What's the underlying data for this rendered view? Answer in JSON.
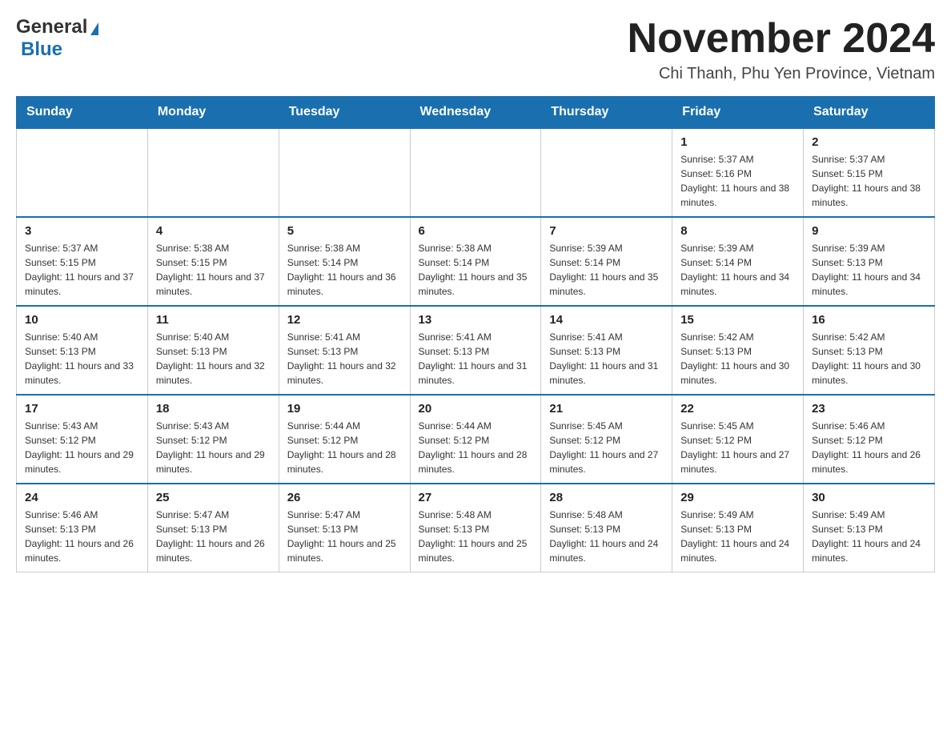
{
  "logo": {
    "general": "General",
    "blue": "Blue"
  },
  "title": "November 2024",
  "location": "Chi Thanh, Phu Yen Province, Vietnam",
  "weekdays": [
    "Sunday",
    "Monday",
    "Tuesday",
    "Wednesday",
    "Thursday",
    "Friday",
    "Saturday"
  ],
  "weeks": [
    [
      {
        "day": "",
        "info": ""
      },
      {
        "day": "",
        "info": ""
      },
      {
        "day": "",
        "info": ""
      },
      {
        "day": "",
        "info": ""
      },
      {
        "day": "",
        "info": ""
      },
      {
        "day": "1",
        "info": "Sunrise: 5:37 AM\nSunset: 5:16 PM\nDaylight: 11 hours and 38 minutes."
      },
      {
        "day": "2",
        "info": "Sunrise: 5:37 AM\nSunset: 5:15 PM\nDaylight: 11 hours and 38 minutes."
      }
    ],
    [
      {
        "day": "3",
        "info": "Sunrise: 5:37 AM\nSunset: 5:15 PM\nDaylight: 11 hours and 37 minutes."
      },
      {
        "day": "4",
        "info": "Sunrise: 5:38 AM\nSunset: 5:15 PM\nDaylight: 11 hours and 37 minutes."
      },
      {
        "day": "5",
        "info": "Sunrise: 5:38 AM\nSunset: 5:14 PM\nDaylight: 11 hours and 36 minutes."
      },
      {
        "day": "6",
        "info": "Sunrise: 5:38 AM\nSunset: 5:14 PM\nDaylight: 11 hours and 35 minutes."
      },
      {
        "day": "7",
        "info": "Sunrise: 5:39 AM\nSunset: 5:14 PM\nDaylight: 11 hours and 35 minutes."
      },
      {
        "day": "8",
        "info": "Sunrise: 5:39 AM\nSunset: 5:14 PM\nDaylight: 11 hours and 34 minutes."
      },
      {
        "day": "9",
        "info": "Sunrise: 5:39 AM\nSunset: 5:13 PM\nDaylight: 11 hours and 34 minutes."
      }
    ],
    [
      {
        "day": "10",
        "info": "Sunrise: 5:40 AM\nSunset: 5:13 PM\nDaylight: 11 hours and 33 minutes."
      },
      {
        "day": "11",
        "info": "Sunrise: 5:40 AM\nSunset: 5:13 PM\nDaylight: 11 hours and 32 minutes."
      },
      {
        "day": "12",
        "info": "Sunrise: 5:41 AM\nSunset: 5:13 PM\nDaylight: 11 hours and 32 minutes."
      },
      {
        "day": "13",
        "info": "Sunrise: 5:41 AM\nSunset: 5:13 PM\nDaylight: 11 hours and 31 minutes."
      },
      {
        "day": "14",
        "info": "Sunrise: 5:41 AM\nSunset: 5:13 PM\nDaylight: 11 hours and 31 minutes."
      },
      {
        "day": "15",
        "info": "Sunrise: 5:42 AM\nSunset: 5:13 PM\nDaylight: 11 hours and 30 minutes."
      },
      {
        "day": "16",
        "info": "Sunrise: 5:42 AM\nSunset: 5:13 PM\nDaylight: 11 hours and 30 minutes."
      }
    ],
    [
      {
        "day": "17",
        "info": "Sunrise: 5:43 AM\nSunset: 5:12 PM\nDaylight: 11 hours and 29 minutes."
      },
      {
        "day": "18",
        "info": "Sunrise: 5:43 AM\nSunset: 5:12 PM\nDaylight: 11 hours and 29 minutes."
      },
      {
        "day": "19",
        "info": "Sunrise: 5:44 AM\nSunset: 5:12 PM\nDaylight: 11 hours and 28 minutes."
      },
      {
        "day": "20",
        "info": "Sunrise: 5:44 AM\nSunset: 5:12 PM\nDaylight: 11 hours and 28 minutes."
      },
      {
        "day": "21",
        "info": "Sunrise: 5:45 AM\nSunset: 5:12 PM\nDaylight: 11 hours and 27 minutes."
      },
      {
        "day": "22",
        "info": "Sunrise: 5:45 AM\nSunset: 5:12 PM\nDaylight: 11 hours and 27 minutes."
      },
      {
        "day": "23",
        "info": "Sunrise: 5:46 AM\nSunset: 5:12 PM\nDaylight: 11 hours and 26 minutes."
      }
    ],
    [
      {
        "day": "24",
        "info": "Sunrise: 5:46 AM\nSunset: 5:13 PM\nDaylight: 11 hours and 26 minutes."
      },
      {
        "day": "25",
        "info": "Sunrise: 5:47 AM\nSunset: 5:13 PM\nDaylight: 11 hours and 26 minutes."
      },
      {
        "day": "26",
        "info": "Sunrise: 5:47 AM\nSunset: 5:13 PM\nDaylight: 11 hours and 25 minutes."
      },
      {
        "day": "27",
        "info": "Sunrise: 5:48 AM\nSunset: 5:13 PM\nDaylight: 11 hours and 25 minutes."
      },
      {
        "day": "28",
        "info": "Sunrise: 5:48 AM\nSunset: 5:13 PM\nDaylight: 11 hours and 24 minutes."
      },
      {
        "day": "29",
        "info": "Sunrise: 5:49 AM\nSunset: 5:13 PM\nDaylight: 11 hours and 24 minutes."
      },
      {
        "day": "30",
        "info": "Sunrise: 5:49 AM\nSunset: 5:13 PM\nDaylight: 11 hours and 24 minutes."
      }
    ]
  ]
}
